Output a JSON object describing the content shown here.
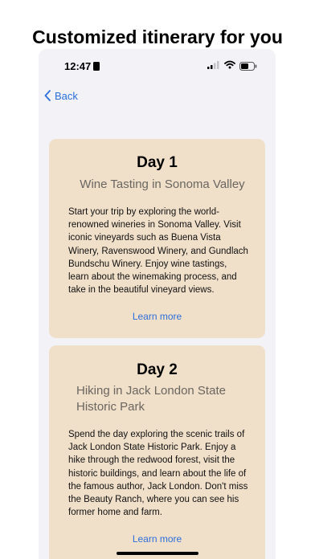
{
  "headline": "Customized itinerary for you",
  "status": {
    "time": "12:47",
    "icons": [
      "id-card-icon",
      "signal-icon",
      "wifi-icon",
      "battery-icon"
    ]
  },
  "nav": {
    "back_label": "Back",
    "accent": "#2c6fda"
  },
  "cards": [
    {
      "day": "Day 1",
      "title": "Wine Tasting in Sonoma Valley",
      "body": "Start your trip by exploring the world-renowned wineries in Sonoma Valley. Visit iconic vineyards such as Buena Vista Winery, Ravenswood Winery, and Gundlach Bundschu Winery. Enjoy wine tastings, learn about the winemaking process, and take in the beautiful vineyard views.",
      "link": "Learn more"
    },
    {
      "day": "Day 2",
      "title": "Hiking in Jack London State Historic Park",
      "body": "Spend the day exploring the scenic trails of Jack London State Historic Park. Enjoy a hike through the redwood forest, visit the historic buildings, and learn about the life of the famous author, Jack London. Don't miss the Beauty Ranch, where you can see his former home and farm.",
      "link": "Learn more"
    }
  ],
  "colors": {
    "card_bg": "#f0dfc9",
    "screen_bg": "#f2f2f7"
  }
}
